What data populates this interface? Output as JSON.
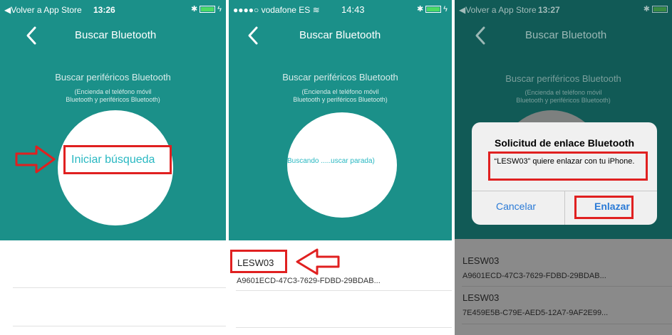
{
  "colors": {
    "teal": "#1b9089",
    "dimmed_teal": "#115a56",
    "circle_text": "#29b8c2",
    "highlight_red": "#e02020",
    "ios_blue": "#2a7ad6"
  },
  "screens": [
    {
      "status": {
        "left": "◀Volver a App Store",
        "time": "13:26"
      },
      "nav_title": "Buscar Bluetooth",
      "heading": "Buscar periféricos Bluetooth",
      "subtext_line1": "(Encienda el teléfono móvil",
      "subtext_line2": "Bluetooth y periféricos Bluetooth)",
      "circle_label": "Iniciar búsqueda"
    },
    {
      "status": {
        "left": "●●●●○ vodafone ES ≋",
        "time": "14:43"
      },
      "nav_title": "Buscar Bluetooth",
      "heading": "Buscar periféricos Bluetooth",
      "subtext_line1": "(Encienda el teléfono móvil",
      "subtext_line2": "Bluetooth y periféricos Bluetooth)",
      "circle_label": "Buscando .....uscar parada)",
      "devices": [
        {
          "name": "LESW03",
          "id": "A9601ECD-47C3-7629-FDBD-29BDAB..."
        }
      ]
    },
    {
      "status": {
        "left": "◀Volver a App Store",
        "time": "13:27"
      },
      "nav_title": "Buscar Bluetooth",
      "heading": "Buscar periféricos Bluetooth",
      "subtext_line1": "(Encienda el teléfono móvil",
      "subtext_line2": "Bluetooth y periféricos Bluetooth)",
      "dialog": {
        "title": "Solicitud de enlace Bluetooth",
        "message": "“LESW03” quiere enlazar con tu iPhone.",
        "cancel_label": "Cancelar",
        "pair_label": "Enlazar"
      },
      "devices": [
        {
          "name": "LESW03",
          "id": "A9601ECD-47C3-7629-FDBD-29BDAB..."
        },
        {
          "name": "LESW03",
          "id": "7E459E5B-C79E-AED5-12A7-9AF2E99..."
        }
      ]
    }
  ],
  "status_icons": {
    "bluetooth": "bluetooth-icon",
    "battery": "battery-icon",
    "charging": "charging-icon"
  }
}
